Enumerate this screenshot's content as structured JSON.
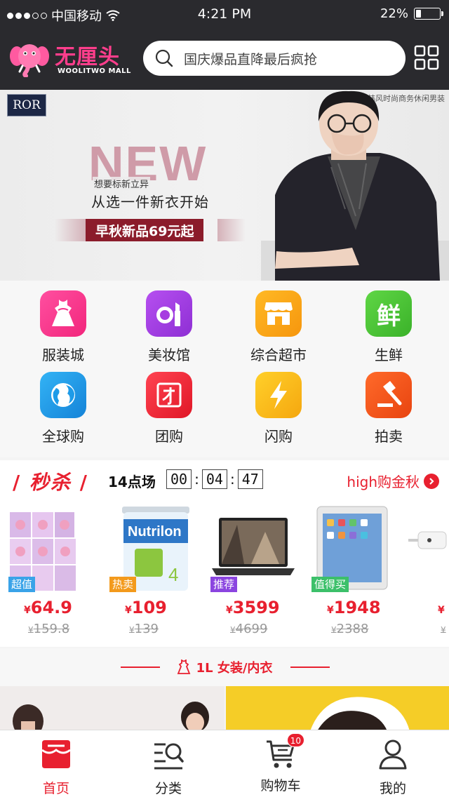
{
  "status_bar": {
    "carrier": "中国移动",
    "time": "4:21 PM",
    "battery": "22%",
    "battery_level": 0.22,
    "signal_bars": 3
  },
  "header": {
    "logo_name": "无厘头",
    "logo_sub": "WOOLITWO MALL",
    "search_placeholder": "国庆爆品直降最后疯抢"
  },
  "banner": {
    "brand": "ROR",
    "brand_line": "韩风时尚商务休闲男装",
    "headline": "NEW",
    "tagline_small": "想要标新立异",
    "tagline": "从选一件新衣开始",
    "promo": "早秋新品69元起"
  },
  "categories": [
    {
      "label": "服装城",
      "icon": "dress-icon",
      "color": "#f5368e"
    },
    {
      "label": "美妆馆",
      "icon": "makeup-icon",
      "color": "#a63de0"
    },
    {
      "label": "综合超市",
      "icon": "store-icon",
      "color": "#fca717"
    },
    {
      "label": "生鲜",
      "icon": "fresh-icon",
      "color": "#4dc536"
    },
    {
      "label": "全球购",
      "icon": "globe-icon",
      "color": "#1e9be8"
    },
    {
      "label": "团购",
      "icon": "group-icon",
      "color": "#f0283a"
    },
    {
      "label": "闪购",
      "icon": "lightning-icon",
      "color": "#fbbd1a"
    },
    {
      "label": "拍卖",
      "icon": "gavel-icon",
      "color": "#f2551d"
    }
  ],
  "flash_sale": {
    "title": "秒杀",
    "session": "14点场",
    "timer": {
      "h": "00",
      "m": "04",
      "s": "47"
    },
    "more": "high购金秋",
    "items": [
      {
        "badge": "超值",
        "badge_color": "#3aa3e8",
        "price": "64.9",
        "old_price": "159.8",
        "currency": "¥",
        "icon": "diapers-image"
      },
      {
        "badge": "热卖",
        "badge_color": "#f39a1c",
        "price": "109",
        "old_price": "139",
        "currency": "¥",
        "icon": "milk-powder-image"
      },
      {
        "badge": "推荐",
        "badge_color": "#8b45e0",
        "price": "3599",
        "old_price": "4699",
        "currency": "¥",
        "icon": "laptop-image"
      },
      {
        "badge": "值得买",
        "badge_color": "#3cc06a",
        "price": "1948",
        "old_price": "2388",
        "currency": "¥",
        "icon": "tablet-image"
      },
      {
        "badge": "",
        "badge_color": "#3aa3e8",
        "price": "",
        "old_price": "",
        "currency": "¥",
        "icon": "cable-image"
      }
    ]
  },
  "floor": {
    "title": "1L 女装/内衣"
  },
  "tabbar": [
    {
      "label": "首页",
      "icon": "home-icon",
      "active": true
    },
    {
      "label": "分类",
      "icon": "category-icon",
      "active": false
    },
    {
      "label": "购物车",
      "icon": "cart-icon",
      "active": false,
      "badge": "10"
    },
    {
      "label": "我的",
      "icon": "user-icon",
      "active": false
    }
  ],
  "colors": {
    "accent": "#e8202f",
    "header_bg": "#2a2a2e",
    "logo_pink": "#ff3e8c"
  }
}
